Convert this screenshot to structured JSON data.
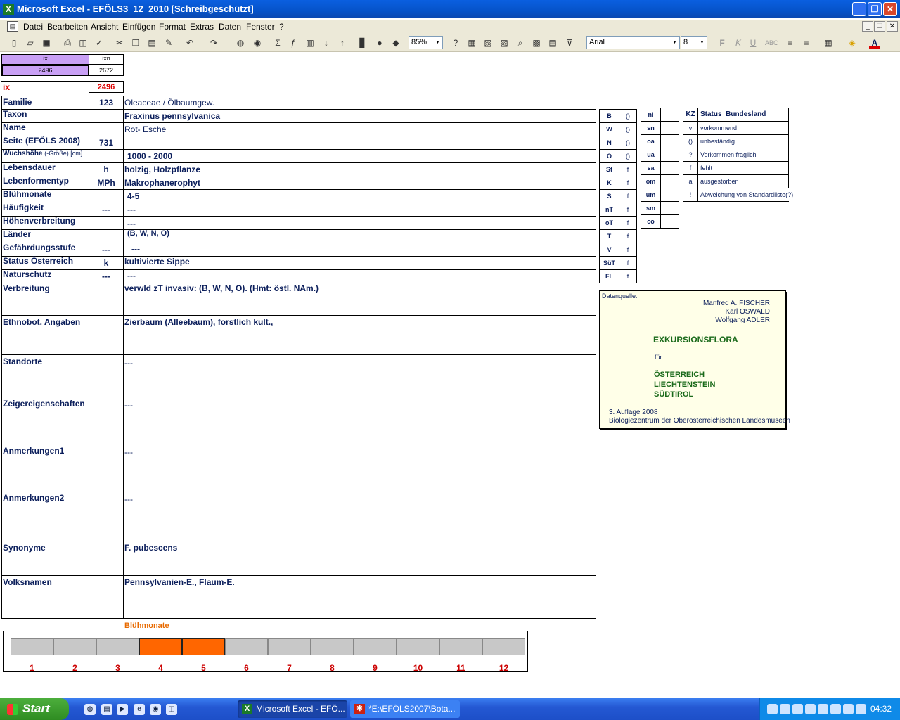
{
  "window": {
    "title": "Microsoft Excel - EFÖLS3_12_2010  [Schreibgeschützt]",
    "min": "_",
    "max": "❐",
    "close": "✕"
  },
  "menu": [
    "Datei",
    "Bearbeiten",
    "Ansicht",
    "Einfügen",
    "Format",
    "Extras",
    "Daten",
    "Fenster",
    "?"
  ],
  "toolbar": {
    "zoom": "85%",
    "font": "Arial",
    "size": "8"
  },
  "index": {
    "ix_label": "ix",
    "ixn_label": "ixn",
    "ix_value": "2496",
    "ixn_value": "2672",
    "ix2_label": "ix",
    "ix2_value": "2496"
  },
  "rows": [
    {
      "label": "Familie",
      "code": "123",
      "value": "Oleaceae  /  Ölbaumgew."
    },
    {
      "label": "Taxon",
      "code": "",
      "value": "Fraxinus pennsylvanica"
    },
    {
      "label": "Name",
      "code": "",
      "value": "Rot- Esche"
    },
    {
      "label": "Seite (EFÖLS 2008)",
      "code": "731",
      "value": ""
    },
    {
      "label": "Wuchshöhe",
      "label_suffix": "(-Größe) [cm]",
      "code": "",
      "value": "1000 - 2000"
    },
    {
      "label": "Lebensdauer",
      "code": "h",
      "value": "holzig, Holzpflanze"
    },
    {
      "label": "Lebenformentyp",
      "code": "MPh",
      "value": "Makrophanerophyt"
    },
    {
      "label": "Blühmonate",
      "code": "",
      "value": "4-5"
    },
    {
      "label": "Häufigkeit",
      "code": "---",
      "value": "---"
    },
    {
      "label": "Höhenverbreitung",
      "code": "",
      "value": "---"
    },
    {
      "label": "Länder",
      "code": "",
      "value": "(B, W, N, O)"
    },
    {
      "label": "Gefährdungsstufe",
      "code": "---",
      "value": "---"
    },
    {
      "label": "Status Österreich",
      "code": "k",
      "value": "kultivierte Sippe"
    },
    {
      "label": "Naturschutz",
      "code": "---",
      "value": "---"
    }
  ],
  "tall_rows": [
    {
      "label": "Verbreitung",
      "value": "verwld zT invasiv: (B, W, N, O). (Hmt: östl. NAm.)"
    },
    {
      "label": "Ethnobot. Angaben",
      "value": "Zierbaum (Alleebaum), forstlich kult.,"
    },
    {
      "label": "Standorte",
      "value": "---"
    },
    {
      "label": "Zeigereigenschaften",
      "value": "---"
    },
    {
      "label": "Anmerkungen1",
      "value": "---"
    },
    {
      "label": "Anmerkungen2",
      "value": "---"
    },
    {
      "label": "Synonyme",
      "value": "F. pubescens"
    },
    {
      "label": "Volksnamen",
      "value": "Pennsylvanien-E., Flaum-E."
    }
  ],
  "states": [
    {
      "k": "B",
      "v": "()"
    },
    {
      "k": "W",
      "v": "()"
    },
    {
      "k": "N",
      "v": "()"
    },
    {
      "k": "O",
      "v": "()"
    },
    {
      "k": "St",
      "v": "f"
    },
    {
      "k": "K",
      "v": "f"
    },
    {
      "k": "S",
      "v": "f"
    },
    {
      "k": "nT",
      "v": "f"
    },
    {
      "k": "oT",
      "v": "f"
    },
    {
      "k": "T",
      "v": "f"
    },
    {
      "k": "V",
      "v": "f"
    },
    {
      "k": "SüT",
      "v": "f"
    },
    {
      "k": "FL",
      "v": "f"
    }
  ],
  "heights": [
    "ni",
    "sn",
    "oa",
    "ua",
    "sa",
    "om",
    "um",
    "sm",
    "co"
  ],
  "legend": {
    "head_k": "KZ",
    "head_v": "Status_Bundesland",
    "items": [
      {
        "k": "v",
        "v": "vorkommend"
      },
      {
        "k": "()",
        "v": "unbeständig"
      },
      {
        "k": "?",
        "v": "Vorkommen fraglich"
      },
      {
        "k": "f",
        "v": "fehlt"
      },
      {
        "k": "a",
        "v": "ausgestorben"
      },
      {
        "k": "!",
        "v": "Abweichung von Standardliste(?)"
      }
    ]
  },
  "source": {
    "label": "Datenquelle:",
    "a1": "Manfred A. FISCHER",
    "a2": "Karl OSWALD",
    "a3": "Wolfgang ADLER",
    "title": "EXKURSIONSFLORA",
    "fuer": "für",
    "c1": "ÖSTERREICH",
    "c2": "LIECHTENSTEIN",
    "c3": "SÜDTIROL",
    "ed": "3. Auflage 2008",
    "pub": "Biologiezentrum der Oberösterreichischen Landesmuseen"
  },
  "months": {
    "title": "Blühmonate",
    "labels": [
      "1",
      "2",
      "3",
      "4",
      "5",
      "6",
      "7",
      "8",
      "9",
      "10",
      "11",
      "12"
    ],
    "active": [
      4,
      5
    ]
  },
  "taskbar": {
    "start": "Start",
    "task1": "Microsoft Excel - EFÖ...",
    "task2": "*E:\\EFÖLS2007\\Bota...",
    "clock": "04:32"
  }
}
